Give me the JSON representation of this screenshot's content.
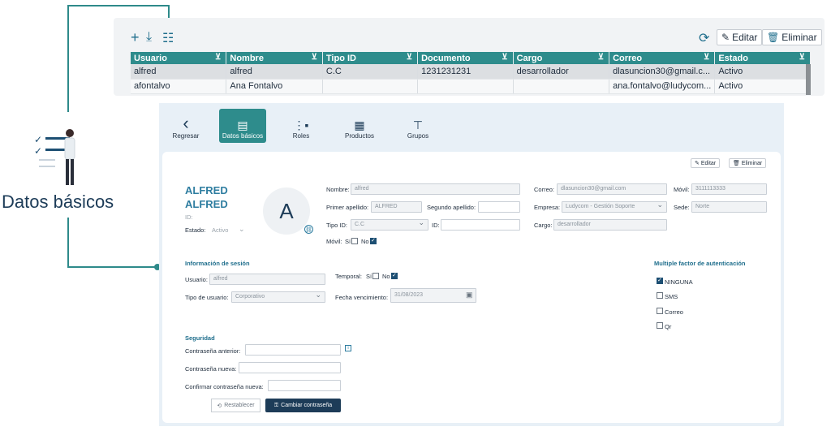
{
  "toolbar": {
    "add_icon": "plus-icon",
    "download_icon": "download-icon",
    "columns_icon": "columns-icon",
    "refresh_icon": "refresh-icon",
    "edit_label": "Editar",
    "delete_label": "Eliminar"
  },
  "table": {
    "headers": [
      "Usuario",
      "Nombre",
      "Tipo ID",
      "Documento",
      "Cargo",
      "Correo",
      "Estado"
    ],
    "rows": [
      [
        "alfred",
        "alfred",
        "C.C",
        "1231231231",
        "desarrollador",
        "dlasuncion30@gmail.c...",
        "Activo"
      ],
      [
        "afontalvo",
        "Ana Fontalvo",
        "",
        "",
        "",
        "ana.fontalvo@ludycom...",
        "Activo"
      ]
    ]
  },
  "callout": {
    "title": "Datos básicos"
  },
  "nav": {
    "back": "Regresar",
    "items": [
      "Datos básicos",
      "Roles",
      "Productos",
      "Grupos"
    ]
  },
  "card": {
    "edit_label": "Editar",
    "delete_label": "Eliminar",
    "name_line1": "ALFRED",
    "name_line2": "ALFRED",
    "id_label": "ID:",
    "estado_label": "Estado:",
    "estado_value": "Activo",
    "avatar_letter": "A",
    "fields": {
      "nombre_label": "Nombre:",
      "nombre_value": "alfred",
      "primer_label": "Primer apellido:",
      "primer_value": "ALFRED",
      "segundo_label": "Segundo apellido:",
      "segundo_value": "",
      "tipoid_label": "Tipo ID:",
      "tipoid_value": "C.C",
      "id_label": "ID:",
      "id_value": "",
      "movil_label": "Móvil:",
      "si_label": "Sí",
      "no_label": "No",
      "correo_label": "Correo:",
      "correo_value": "dlasuncion30@gmail.com",
      "movil2_label": "Móvil:",
      "movil2_value": "3111113333",
      "empresa_label": "Empresa:",
      "empresa_value": "Ludycom - Gestión Soporte",
      "sede_label": "Sede:",
      "sede_value": "Norte",
      "cargo_label": "Cargo:",
      "cargo_value": "desarrollador"
    },
    "session": {
      "title": "Información de sesión",
      "usuario_label": "Usuario:",
      "usuario_value": "alfred",
      "temporal_label": "Temporal:",
      "si_label": "Sí",
      "no_label": "No",
      "tipo_label": "Tipo de usuario:",
      "tipo_value": "Corporativo",
      "fecha_label": "Fecha vencimiento:",
      "fecha_value": "31/08/2023"
    },
    "mfa": {
      "title": "Multiple factor de autenticación",
      "options": [
        "NINGUNA",
        "SMS",
        "Correo",
        "Qr"
      ]
    },
    "security": {
      "title": "Seguridad",
      "anterior_label": "Contraseña anterior:",
      "nueva_label": "Contraseña nueva:",
      "confirmar_label": "Confirmar contraseña nueva:",
      "reset_label": "Restablecer",
      "change_label": "Cambiar contraseña"
    }
  }
}
